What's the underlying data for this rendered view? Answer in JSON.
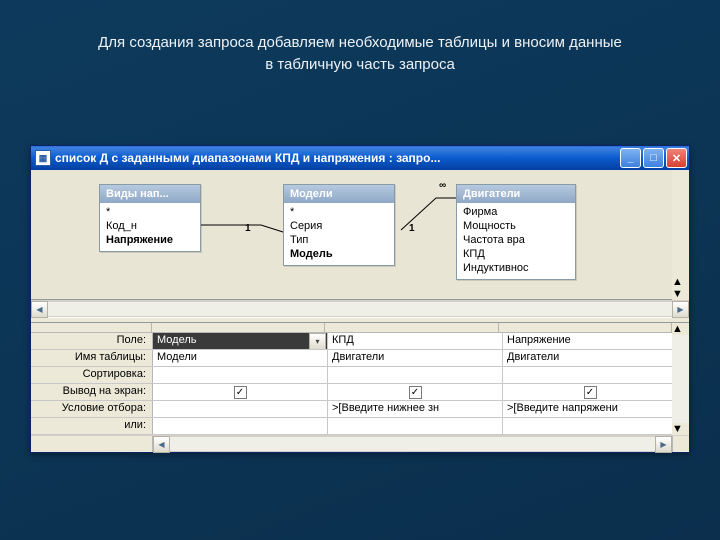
{
  "caption_line1": "Для создания запроса добавляем необходимые таблицы и вносим данные",
  "caption_line2": "в табличную часть запроса",
  "window": {
    "title": "список Д с заданными диапазонами КПД и напряжения : запро..."
  },
  "tables": {
    "t1": {
      "title": "Виды нап...",
      "rows": [
        "*",
        "Код_н",
        "Напряжение"
      ],
      "bold_idx": 2
    },
    "t2": {
      "title": "Модели",
      "rows": [
        "*",
        "Серия",
        "Тип",
        "Модель"
      ],
      "bold_idx": 3
    },
    "t3": {
      "title": "Двигатели",
      "rows": [
        "Фирма",
        "Мощность",
        "Частота вра",
        "КПД",
        "Индуктивнос"
      ],
      "bold_idx": -1
    }
  },
  "rel": {
    "one_a": "1",
    "one_b": "1",
    "inf": "∞"
  },
  "grid": {
    "labels": {
      "field": "Поле:",
      "table": "Имя таблицы:",
      "sort": "Сортировка:",
      "show": "Вывод на экран:",
      "criteria": "Условие отбора:",
      "or": "или:"
    },
    "cols": [
      {
        "field": "Модель",
        "table": "Модели",
        "criteria": "",
        "selected": true
      },
      {
        "field": "КПД",
        "table": "Двигатели",
        "criteria": ">[Введите нижнее зн"
      },
      {
        "field": "Напряжение",
        "table": "Двигатели",
        "criteria": ">[Введите напряжени"
      }
    ],
    "check": "✓"
  }
}
